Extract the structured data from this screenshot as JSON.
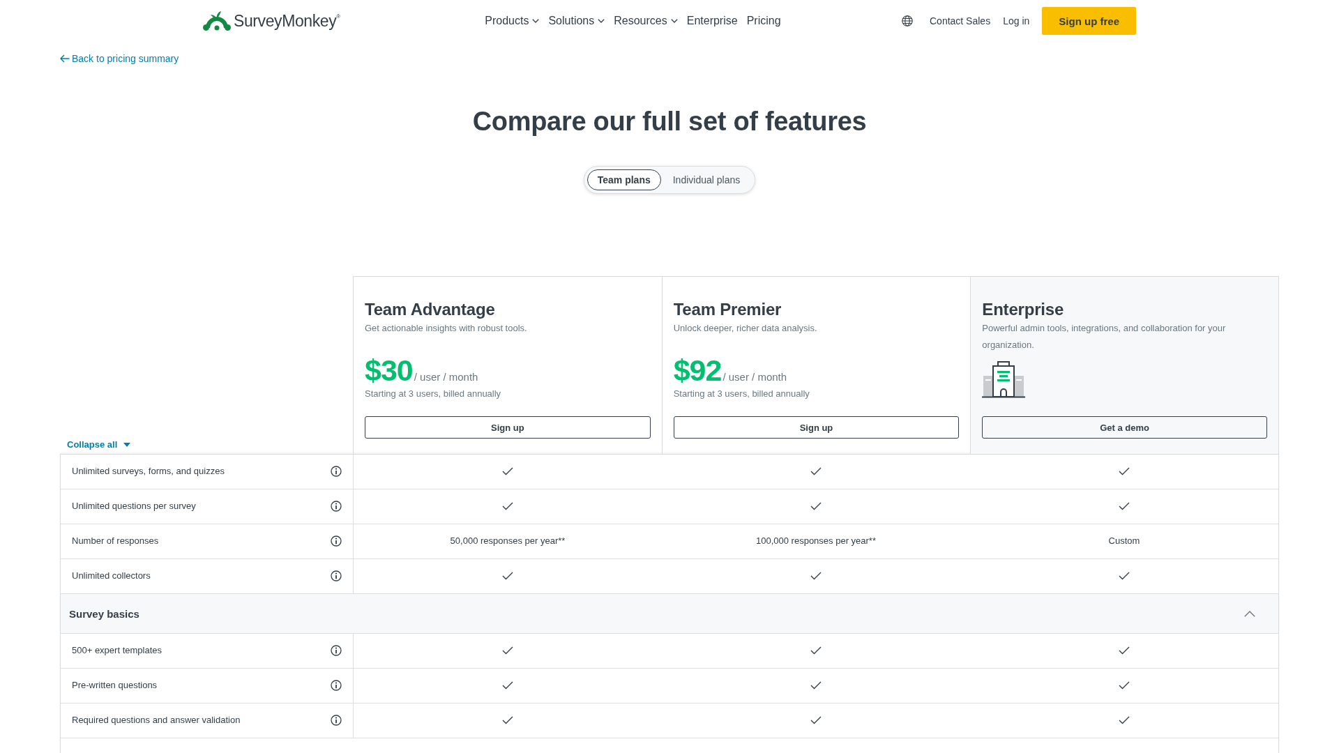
{
  "header": {
    "logo": "SurveyMonkey$^{®}$",
    "nav": [
      {
        "label": "Products",
        "has_menu": true
      },
      {
        "label": "Solutions",
        "has_menu": true
      },
      {
        "label": "Resources",
        "has_menu": true
      },
      {
        "label": "Enterprise",
        "has_menu": false
      },
      {
        "label": "Pricing",
        "has_menu": false
      }
    ],
    "contact": "Contact Sales",
    "login": "Log in",
    "signup": "Sign up free"
  },
  "back_link": "Back to pricing summary",
  "title": "Compare our full set of features",
  "plan_toggle": [
    {
      "label": "Team plans",
      "selected": true
    },
    {
      "label": "Individual plans",
      "selected": false
    }
  ],
  "plans": [
    {
      "kind": "priced",
      "name": "Team Advantage",
      "description": "Get actionable insights with robust tools.",
      "price": "$30",
      "period": "/ user / month",
      "note": "Starting at 3 users, billed annually",
      "button": "Sign up"
    },
    {
      "kind": "priced",
      "name": "Team Premier",
      "description": "Unlock deeper, richer data analysis.",
      "price": "$92",
      "period": "/ user / month",
      "note": "Starting at 3 users, billed annually",
      "button": "Sign up"
    },
    {
      "kind": "contact",
      "name": "Enterprise",
      "description": "Powerful admin tools, integrations, and collaboration for your organization.",
      "button": "Get a demo"
    }
  ],
  "collapse_all": "Collapse all",
  "features": [
    {
      "label": "Unlimited surveys, forms, and quizzes",
      "values": [
        {
          "kind": "check"
        },
        {
          "kind": "check"
        },
        {
          "kind": "check"
        }
      ]
    },
    {
      "label": "Unlimited questions per survey",
      "values": [
        {
          "kind": "check"
        },
        {
          "kind": "check"
        },
        {
          "kind": "check"
        }
      ]
    },
    {
      "label": "Number of responses",
      "values": [
        {
          "kind": "text",
          "text": "50,000 responses per year**"
        },
        {
          "kind": "text",
          "text": "100,000 responses per year**"
        },
        {
          "kind": "text",
          "text": "Custom"
        }
      ]
    },
    {
      "label": "Unlimited collectors",
      "values": [
        {
          "kind": "check"
        },
        {
          "kind": "check"
        },
        {
          "kind": "check"
        }
      ]
    }
  ],
  "sections": [
    {
      "title": "Survey basics",
      "expanded": true,
      "rows": [
        {
          "label": "500+ expert templates",
          "values": [
            {
              "kind": "check"
            },
            {
              "kind": "check"
            },
            {
              "kind": "check"
            }
          ]
        },
        {
          "label": "Pre-written questions",
          "values": [
            {
              "kind": "check"
            },
            {
              "kind": "check"
            },
            {
              "kind": "check"
            }
          ]
        },
        {
          "label": "Required questions and answer validation",
          "values": [
            {
              "kind": "check"
            },
            {
              "kind": "check"
            },
            {
              "kind": "check"
            }
          ]
        }
      ]
    }
  ]
}
